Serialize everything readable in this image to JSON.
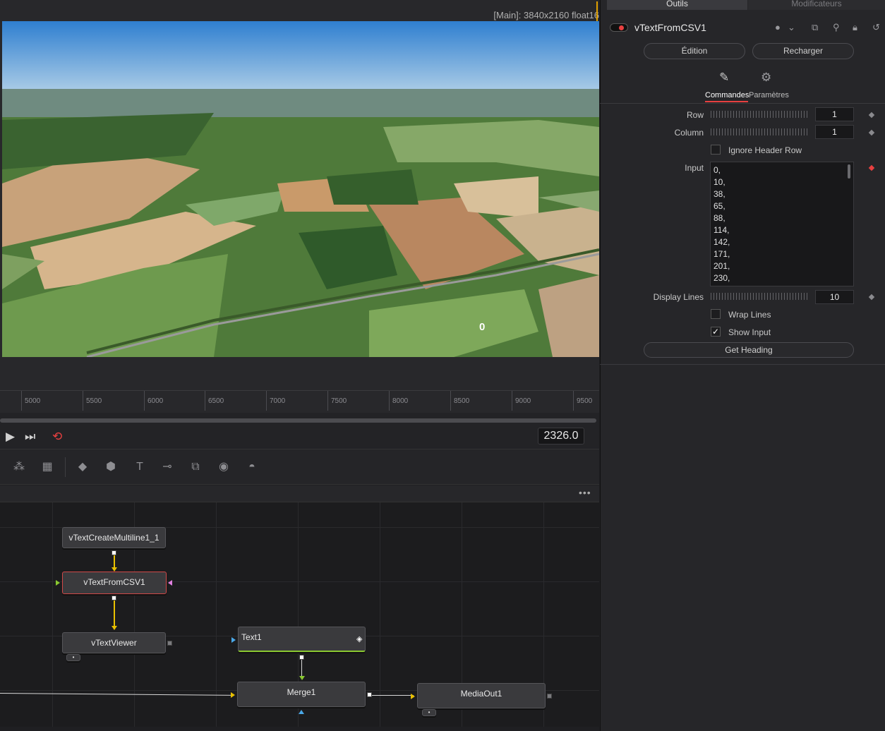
{
  "viewer": {
    "info": "[Main]: 3840x2160 float16",
    "overlay_value": "0"
  },
  "ruler": {
    "ticks": [
      "5000",
      "5500",
      "6000",
      "6500",
      "7000",
      "7500",
      "8000",
      "8500",
      "9000",
      "9500"
    ]
  },
  "transport": {
    "play_icon": "play-icon",
    "skip_end_icon": "skip-to-end-icon",
    "loop_icon": "loop-icon",
    "timecode": "2326.0",
    "loop_color": "#e84040"
  },
  "toolbar": {
    "icons": [
      "particle-emitter-icon",
      "particle-render-icon",
      "shape-3d-icon",
      "merge-3d-icon",
      "text-3d-icon",
      "camera-3d-icon",
      "image-plane-3d-icon",
      "renderer-3d-icon",
      "spotlight-3d-icon"
    ]
  },
  "nodes": {
    "create_multiline": "vTextCreateMultiline1_1",
    "from_csv": "vTextFromCSV1",
    "viewer": "vTextViewer",
    "text1": "Text1",
    "merge1": "Merge1",
    "media_out": "MediaOut1"
  },
  "inspector": {
    "tabs": [
      "Outils",
      "Modificateurs"
    ],
    "tool_title": "vTextFromCSV1",
    "edit_button": "Édition",
    "reload_button": "Recharger",
    "subtabs": [
      "Commandes",
      "Paramètres"
    ],
    "fields": {
      "row_label": "Row",
      "row_value": "1",
      "column_label": "Column",
      "column_value": "1",
      "ignore_header_label": "Ignore Header Row",
      "input_label": "Input",
      "input_lines": [
        "0,",
        "10,",
        "38,",
        "65,",
        "88,",
        "114,",
        "142,",
        "171,",
        "201,",
        "230,"
      ],
      "display_lines_label": "Display Lines",
      "display_lines_value": "10",
      "wrap_lines_label": "Wrap Lines",
      "show_input_label": "Show Input",
      "show_input_checked": true,
      "get_heading_button": "Get Heading"
    },
    "accent": "#e84040"
  }
}
